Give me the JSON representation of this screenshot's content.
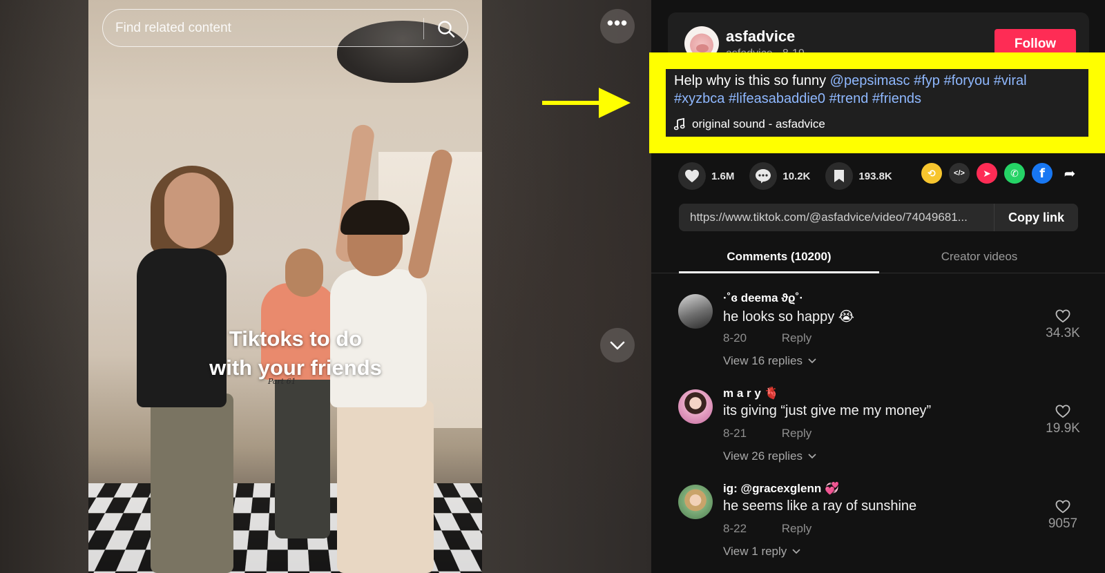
{
  "search": {
    "placeholder": "Find related content"
  },
  "video": {
    "caption_line1": "Tiktoks to do",
    "caption_line2": "with your friends",
    "part_label": "Part 61"
  },
  "author": {
    "username": "asfadvice",
    "subline": "asfadvice · 8-19",
    "follow_label": "Follow"
  },
  "post": {
    "description_text": "Help why is this so funny ",
    "mention": "@pepsimasc",
    "hashtags": [
      "#fyp",
      "#foryou",
      "#viral",
      "#xyzbca",
      "#lifeasabaddie0",
      "#trend",
      "#friends"
    ],
    "sound": "original sound - asfadvice"
  },
  "stats": {
    "likes": "1.6M",
    "comments": "10.2K",
    "saves": "193.8K"
  },
  "link": {
    "url": "https://www.tiktok.com/@asfadvice/video/74049681...",
    "copy_label": "Copy link"
  },
  "tabs": {
    "comments": "Comments (10200)",
    "creator": "Creator videos"
  },
  "comments": [
    {
      "name": "·˚ɞ deema ϑϱ˚·",
      "text": "he looks so happy 😭",
      "date": "8-20",
      "reply": "Reply",
      "view": "View 16 replies",
      "likes": "34.3K"
    },
    {
      "name": "m a r y 🫀",
      "text": "its giving “just give me my money”",
      "date": "8-21",
      "reply": "Reply",
      "view": "View 26 replies",
      "likes": "19.9K"
    },
    {
      "name": "ig: @gracexglenn 💞",
      "text": "he seems like a ray of sunshine",
      "date": "8-22",
      "reply": "Reply",
      "view": "View 1 reply",
      "likes": "9057"
    }
  ],
  "colors": {
    "follow": "#fe2c55",
    "highlight": "#ffff00",
    "hashtag": "#8fb8ff",
    "panel_bg": "#121212"
  }
}
